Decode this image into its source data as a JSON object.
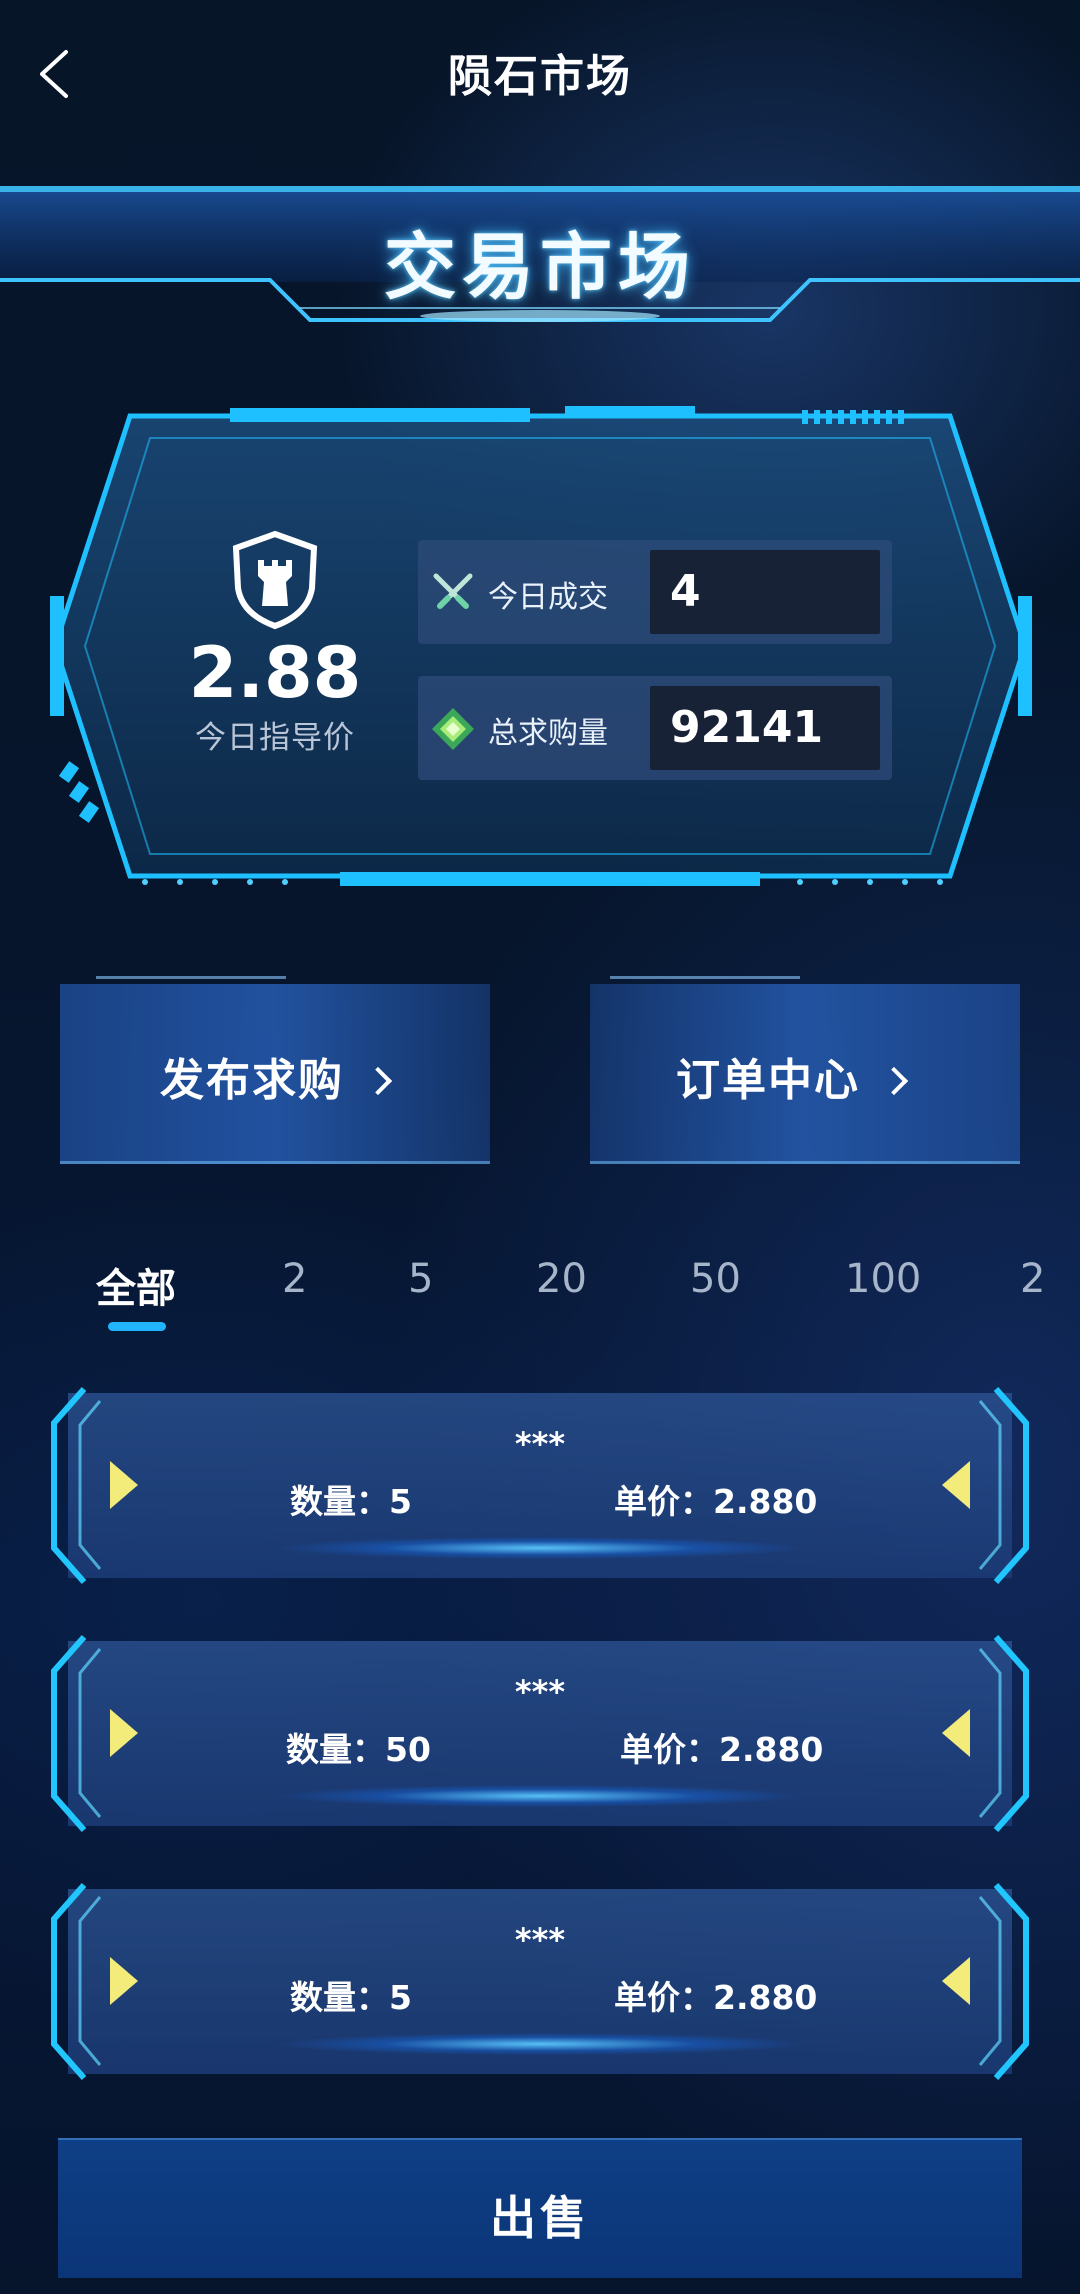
{
  "header": {
    "title": "陨石市场"
  },
  "banner": {
    "title": "交易市场"
  },
  "stats": {
    "guide_price": "2.88",
    "guide_label": "今日指导价",
    "today_deals_label": "今日成交",
    "today_deals_value": "4",
    "total_demand_label": "总求购量",
    "total_demand_value": "92141"
  },
  "actions": {
    "publish_label": "发布求购",
    "orders_label": "订单中心"
  },
  "filters": {
    "tabs": [
      "全部",
      "2",
      "5",
      "20",
      "50",
      "100",
      "2"
    ],
    "active_index": 0
  },
  "orders": [
    {
      "name": "***",
      "qty_label": "数量：",
      "qty": "5",
      "price_label": "单价：",
      "price": "2.880"
    },
    {
      "name": "***",
      "qty_label": "数量：",
      "qty": "50",
      "price_label": "单价：",
      "price": "2.880"
    },
    {
      "name": "***",
      "qty_label": "数量：",
      "qty": "5",
      "price_label": "单价：",
      "price": "2.880"
    }
  ],
  "footer": {
    "sell_label": "出售"
  },
  "colors": {
    "accent": "#21b4ff",
    "arrow_yellow": "#f4ec7a",
    "frame_cyan": "#1fc0ff"
  }
}
